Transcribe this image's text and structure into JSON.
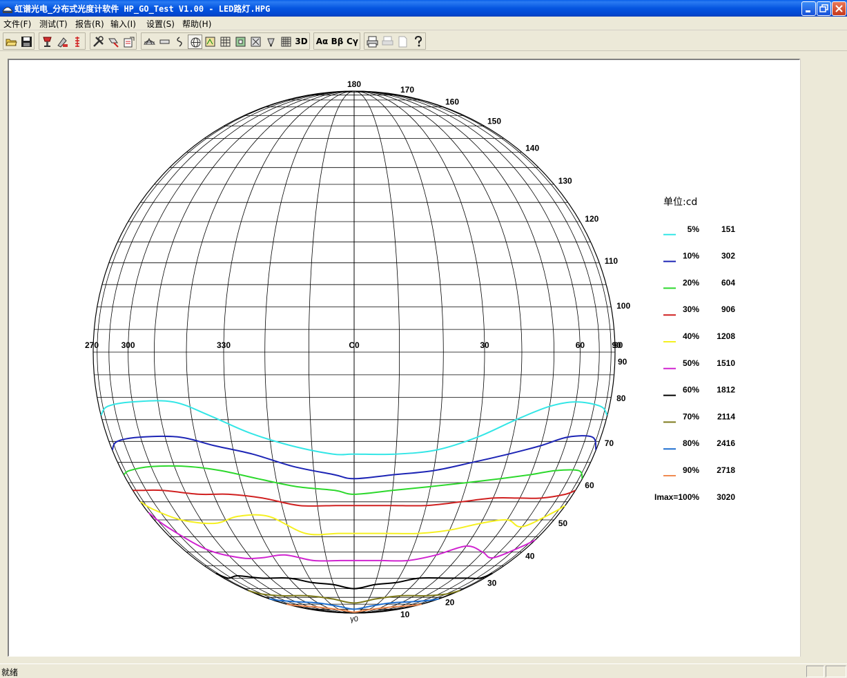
{
  "window": {
    "title": "虹谱光电_分布式光度计软件 HP_GO_Test V1.00 - LED路灯.HPG",
    "app_icon": "photometer-app-icon",
    "controls": [
      "minimize-icon",
      "restore-icon",
      "close-icon"
    ]
  },
  "menu": [
    {
      "label": "文件(F)"
    },
    {
      "label": "测试(T)"
    },
    {
      "label": "报告(R)"
    },
    {
      "label": "输入(I)"
    },
    {
      "label": "设置(S)"
    },
    {
      "label": "帮助(H)"
    }
  ],
  "toolbar": {
    "groups": [
      [
        "open-folder-icon",
        "save-disk-icon"
      ],
      [
        "lamp-test-icon",
        "measure-icon",
        "red-scale-icon"
      ],
      [
        "tools-icon",
        "calibrate-icon",
        "report-edit-icon"
      ],
      [
        "half-dome-icon",
        "bar-icon",
        "polar-curve-icon",
        "globe-icon",
        "document-icon",
        "grid-icon",
        "box-a-icon",
        "box-b-icon",
        "cone-icon",
        "dense-grid-icon",
        "3d-view-icon"
      ],
      [
        "alpha-icon",
        "beta-icon",
        "gamma-icon"
      ],
      [
        "print-icon",
        "print-preview-icon",
        "page-setup-icon",
        "help-icon"
      ]
    ],
    "text_buttons": {
      "3d": "3D",
      "alpha": "Aα",
      "beta": "Bβ",
      "gamma": "Cγ"
    },
    "pressed": "globe-icon"
  },
  "chart_data": {
    "type": "isocandela",
    "projection": "sphere-c-gamma",
    "c_labels_top_row": [
      "270",
      "300",
      "330",
      "C0",
      "30",
      "60",
      "90"
    ],
    "gamma_labels_right": [
      "180",
      "170",
      "160",
      "150",
      "140",
      "130",
      "120",
      "110",
      "100",
      "90",
      "90",
      "80",
      "70",
      "60",
      "50",
      "40",
      "30",
      "20",
      "10"
    ],
    "gamma_bottom_label": "γ0",
    "legend": {
      "title": "单位:cd",
      "entries": [
        {
          "pct": "5%",
          "value": "151",
          "color": "#33E6E6"
        },
        {
          "pct": "10%",
          "value": "302",
          "color": "#1C24B5"
        },
        {
          "pct": "20%",
          "value": "604",
          "color": "#2CD82C"
        },
        {
          "pct": "30%",
          "value": "906",
          "color": "#D02020"
        },
        {
          "pct": "40%",
          "value": "1208",
          "color": "#F5F020"
        },
        {
          "pct": "50%",
          "value": "1510",
          "color": "#D024D0"
        },
        {
          "pct": "60%",
          "value": "1812",
          "color": "#000000"
        },
        {
          "pct": "70%",
          "value": "2114",
          "color": "#7E7A1C"
        },
        {
          "pct": "80%",
          "value": "2416",
          "color": "#1E6FD0"
        },
        {
          "pct": "90%",
          "value": "2718",
          "color": "#F08A50"
        }
      ],
      "imax_label": "Imax=100%",
      "imax_value": "3020"
    },
    "contours": [
      {
        "pct": 5,
        "c": [
          -88,
          -75,
          -60,
          -45,
          -35,
          -25,
          -15,
          -5,
          0,
          10,
          20,
          30,
          40,
          50,
          60,
          75,
          88
        ],
        "gamma": [
          76,
          78,
          79,
          79,
          76,
          72,
          69,
          67,
          67,
          67,
          68,
          71,
          75,
          78,
          79,
          78,
          76
        ]
      },
      {
        "pct": 10,
        "c": [
          -88,
          -75,
          -60,
          -45,
          -35,
          -25,
          -15,
          -5,
          0,
          10,
          20,
          30,
          40,
          50,
          60,
          75,
          88
        ],
        "gamma": [
          68,
          70,
          71,
          71,
          69,
          67,
          64,
          62,
          61,
          62,
          63,
          65,
          67,
          69,
          71,
          71,
          68
        ]
      },
      {
        "pct": 20,
        "c": [
          -88,
          -75,
          -60,
          -45,
          -35,
          -25,
          -15,
          -5,
          0,
          10,
          20,
          30,
          40,
          50,
          60,
          75,
          88
        ],
        "gamma": [
          62,
          63,
          64,
          64,
          63,
          61,
          59,
          58,
          57,
          58,
          59,
          60,
          61,
          62,
          63,
          63,
          61
        ]
      },
      {
        "pct": 30,
        "c": [
          -88,
          -75,
          -60,
          -45,
          -35,
          -25,
          -15,
          -5,
          0,
          10,
          20,
          30,
          40,
          50,
          60,
          75,
          88
        ],
        "gamma": [
          58,
          58,
          58,
          57,
          57,
          56,
          54,
          54,
          54,
          54,
          54,
          55,
          56,
          56,
          56,
          57,
          58
        ]
      },
      {
        "pct": 40,
        "c": [
          -88,
          -75,
          -60,
          -45,
          -35,
          -25,
          -15,
          -5,
          0,
          10,
          20,
          30,
          40,
          50,
          60,
          75,
          88
        ],
        "gamma": [
          55,
          53,
          50,
          49,
          51,
          51,
          46,
          46,
          46,
          46,
          46,
          47,
          49,
          50,
          48,
          52,
          54
        ]
      },
      {
        "pct": 50,
        "c": [
          -88,
          -75,
          -60,
          -45,
          -35,
          -25,
          -15,
          -5,
          0,
          10,
          20,
          30,
          40,
          50,
          60,
          75,
          88
        ],
        "gamma": [
          52,
          48,
          41,
          38,
          38,
          39,
          37,
          37,
          37,
          37,
          37,
          39,
          42,
          40,
          38,
          42,
          44
        ]
      },
      {
        "pct": 60,
        "c": [
          -88,
          -75,
          -60,
          -45,
          -30,
          -20,
          -10,
          0,
          10,
          20,
          30,
          45,
          60,
          75,
          88
        ],
        "gamma": [
          32,
          30,
          31,
          30,
          30,
          28,
          27,
          25,
          27,
          28,
          30,
          30,
          30,
          30,
          32
        ]
      },
      {
        "pct": 70,
        "c": [
          -88,
          -70,
          -50,
          -30,
          -15,
          0,
          15,
          30,
          50,
          70,
          88
        ],
        "gamma": [
          24,
          22,
          21,
          21,
          19,
          16,
          19,
          21,
          21,
          22,
          24
        ]
      },
      {
        "pct": 80,
        "c": [
          -88,
          -70,
          -50,
          -30,
          -15,
          0,
          15,
          30,
          50,
          70,
          88
        ],
        "gamma": [
          19,
          18,
          17,
          16,
          13,
          10,
          13,
          16,
          17,
          18,
          19
        ]
      },
      {
        "pct": 90,
        "c": [
          -88,
          -70,
          -50,
          -30,
          -15,
          0,
          15,
          30,
          50,
          70,
          88
        ],
        "gamma": [
          15,
          14,
          13,
          11,
          8,
          5,
          8,
          11,
          13,
          14,
          15
        ]
      }
    ]
  },
  "status": {
    "text": "就绪"
  }
}
